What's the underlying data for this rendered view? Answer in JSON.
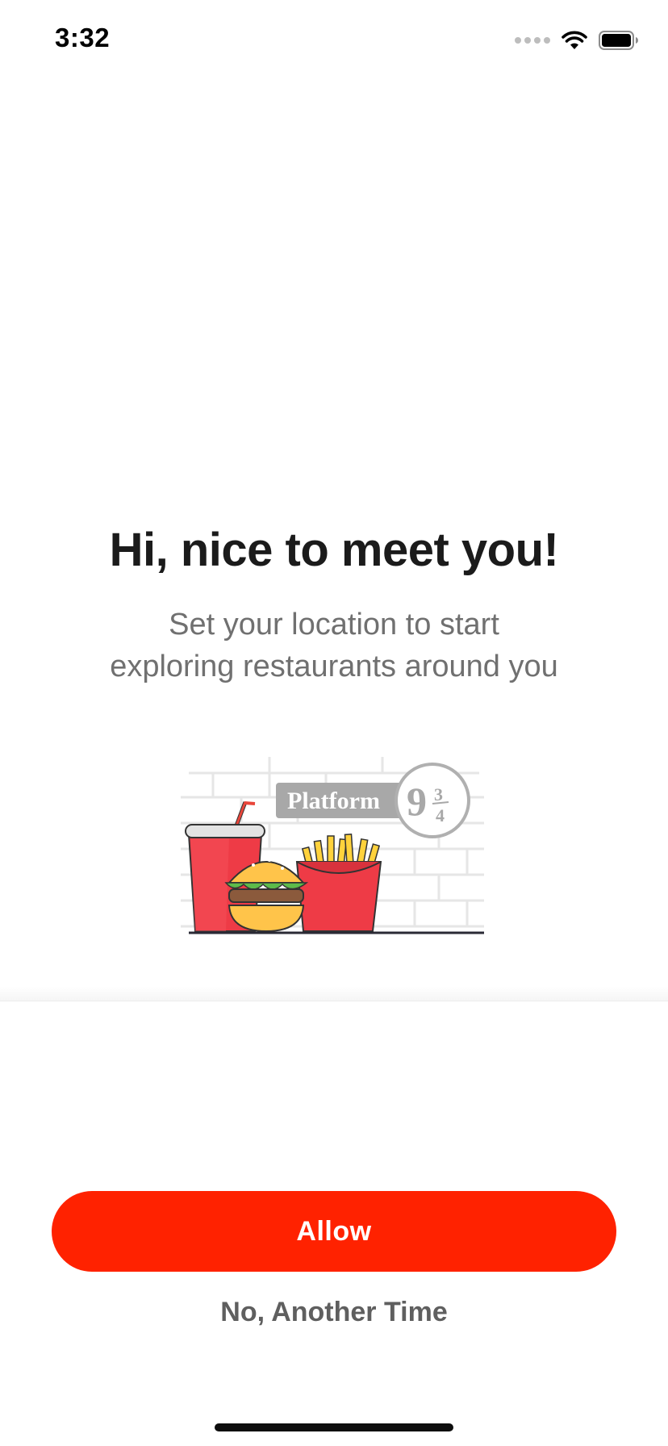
{
  "status_bar": {
    "time": "3:32",
    "signal_icon": "cellular-signal-icon",
    "wifi_icon": "wifi-icon",
    "battery_icon": "battery-icon"
  },
  "welcome": {
    "headline": "Hi, nice to meet you!",
    "subtext_line1": "Set your location to start",
    "subtext_line2": "exploring restaurants around you"
  },
  "illustration": {
    "sign_text": "Platform",
    "sign_number": "9",
    "sign_fraction_top": "3",
    "sign_fraction_bottom": "4",
    "icon": "fast-food-illustration"
  },
  "actions": {
    "allow_label": "Allow",
    "later_label": "No, Another Time"
  },
  "colors": {
    "accent": "#ff2200",
    "headline": "#1b1b1b",
    "subtext": "#707070",
    "secondary_button": "#5f5f5f"
  }
}
